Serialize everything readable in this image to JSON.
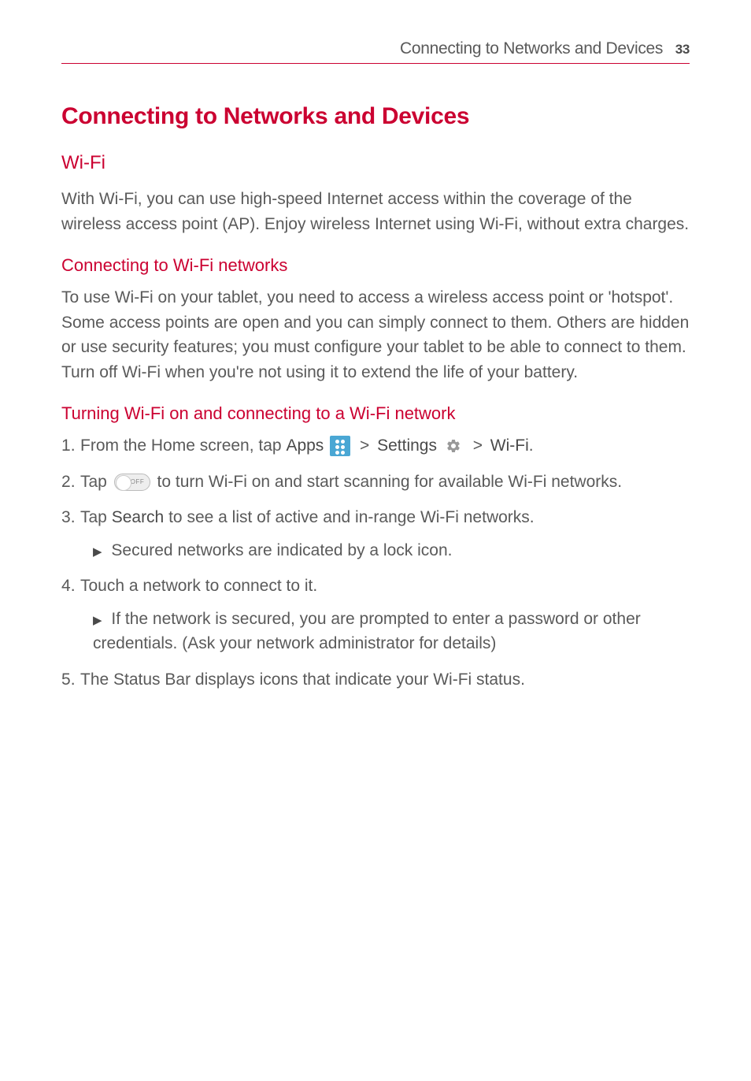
{
  "header": {
    "section_name": "Connecting to Networks and Devices",
    "page_number": "33"
  },
  "main_title": "Connecting to Networks and Devices",
  "wifi": {
    "heading": "Wi-Fi",
    "intro": "With Wi-Fi, you can use high-speed Internet access within the coverage of the wireless access point (AP). Enjoy wireless Internet using Wi-Fi, without extra charges."
  },
  "connecting": {
    "heading": "Connecting to Wi-Fi networks",
    "body": "To use Wi-Fi on your tablet, you need to access a wireless access point or 'hotspot'. Some access points are open and you can simply connect to them. Others are hidden or use security features; you must configure your tablet to be able to connect to them. Turn off Wi-Fi when you're not using it to extend the life of your battery."
  },
  "turning_on": {
    "heading": "Turning Wi-Fi on and connecting to a Wi-Fi network",
    "step1_prefix": "From the Home screen, tap ",
    "step1_apps": "Apps",
    "step1_settings": "Settings",
    "step1_wifi": "Wi-Fi",
    "step1_gt": ">",
    "step1_period": ".",
    "step2_a": "Tap ",
    "step2_b": " to turn Wi-Fi on and start scanning for available Wi-Fi networks.",
    "toggle_label": "OFF",
    "step3_a": "Tap ",
    "step3_search": "Search",
    "step3_b": " to see a list of active and in-range Wi-Fi networks.",
    "step3_sub": "Secured networks are indicated by a lock icon.",
    "step4": "Touch a network to connect to it.",
    "step4_sub": "If the network is secured, you are prompted to enter a password or other credentials. (Ask your network administrator for details)",
    "step5": "The Status Bar displays icons that indicate your Wi-Fi status."
  }
}
